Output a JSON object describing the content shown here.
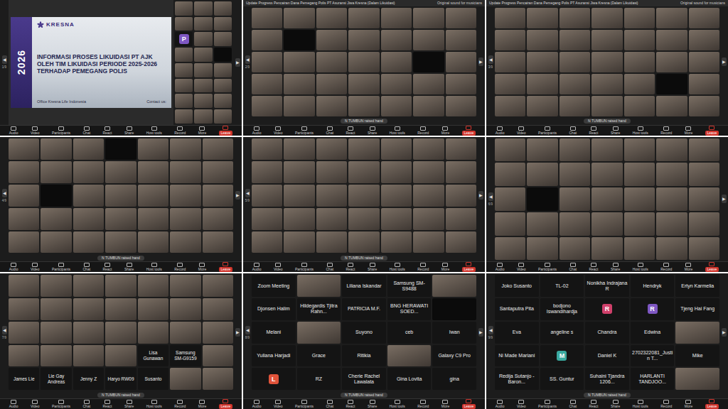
{
  "pager": {
    "prev": "◀",
    "next": "▶"
  },
  "toolbar": [
    {
      "label": "Audio",
      "kind": "button"
    },
    {
      "label": "Video",
      "kind": "button"
    },
    {
      "label": "Participants",
      "kind": "button"
    },
    {
      "label": "Chat",
      "kind": "button"
    },
    {
      "label": "React",
      "kind": "button"
    },
    {
      "label": "Share",
      "kind": "button"
    },
    {
      "label": "Host tools",
      "kind": "button"
    },
    {
      "label": "Record",
      "kind": "button"
    },
    {
      "label": "More",
      "kind": "button"
    },
    {
      "label": "Leave",
      "kind": "leave"
    }
  ],
  "panels": [
    {
      "kind": "slide",
      "header": null,
      "page": "1/9",
      "notice": null,
      "slide": {
        "year": "2026",
        "brand": "KRESNA",
        "title": "INFORMASI PROSES LIKUIDASI PT AJK OLEH TIM LIKUIDASI PERIODE 2025-2026 TERHADAP PEMEGANG POLIS",
        "office": "Office Kresna Life Indonesia",
        "contact": "Contact us:"
      },
      "tiles": [
        {
          "kind": "video"
        },
        {
          "kind": "video"
        },
        {
          "kind": "video"
        },
        {
          "kind": "video"
        },
        {
          "kind": "video"
        },
        {
          "kind": "video"
        },
        {
          "kind": "avatar",
          "letter": "P",
          "color": "#7e57c2"
        },
        {
          "kind": "video"
        },
        {
          "kind": "video"
        },
        {
          "kind": "video"
        },
        {
          "kind": "video"
        },
        {
          "kind": "blank"
        },
        {
          "kind": "video"
        },
        {
          "kind": "video"
        },
        {
          "kind": "video"
        },
        {
          "kind": "video"
        },
        {
          "kind": "video"
        },
        {
          "kind": "video"
        },
        {
          "kind": "video"
        },
        {
          "kind": "video"
        },
        {
          "kind": "video"
        },
        {
          "kind": "video"
        },
        {
          "kind": "video"
        },
        {
          "kind": "video"
        }
      ]
    },
    {
      "kind": "gallery",
      "header": {
        "title": "Update Progress Pencairan Dana Pemegang Polis PT Asuransi Jiwa Kresna (Dalam Likuidasi)",
        "status": "Original sound for musicians"
      },
      "page": "2/9",
      "notice": "N TUMBUN raised hand",
      "tiles": [
        {
          "kind": "video"
        },
        {
          "kind": "video"
        },
        {
          "kind": "video"
        },
        {
          "kind": "video"
        },
        {
          "kind": "video"
        },
        {
          "kind": "video"
        },
        {
          "kind": "video"
        },
        {
          "kind": "video"
        },
        {
          "kind": "blank"
        },
        {
          "kind": "video"
        },
        {
          "kind": "video"
        },
        {
          "kind": "video"
        },
        {
          "kind": "video"
        },
        {
          "kind": "video"
        },
        {
          "kind": "video"
        },
        {
          "kind": "video"
        },
        {
          "kind": "video"
        },
        {
          "kind": "video"
        },
        {
          "kind": "video"
        },
        {
          "kind": "blank"
        },
        {
          "kind": "video"
        },
        {
          "kind": "video"
        },
        {
          "kind": "video"
        },
        {
          "kind": "video"
        },
        {
          "kind": "video"
        },
        {
          "kind": "video"
        },
        {
          "kind": "video"
        },
        {
          "kind": "video"
        },
        {
          "kind": "video"
        },
        {
          "kind": "video"
        },
        {
          "kind": "video"
        },
        {
          "kind": "video"
        },
        {
          "kind": "video"
        },
        {
          "kind": "video"
        },
        {
          "kind": "video"
        }
      ]
    },
    {
      "kind": "gallery",
      "header": {
        "title": "Update Progress Pencairan Dana Pemegang Polis PT Asuransi Jiwa Kresna (Dalam Likuidasi)",
        "status": "Original sound for musicians"
      },
      "page": "3/9",
      "notice": "N TUMBUN raised hand",
      "tiles": [
        {
          "kind": "video"
        },
        {
          "kind": "video"
        },
        {
          "kind": "video"
        },
        {
          "kind": "video"
        },
        {
          "kind": "video"
        },
        {
          "kind": "video"
        },
        {
          "kind": "video"
        },
        {
          "kind": "video"
        },
        {
          "kind": "video"
        },
        {
          "kind": "video"
        },
        {
          "kind": "video"
        },
        {
          "kind": "video"
        },
        {
          "kind": "video"
        },
        {
          "kind": "video"
        },
        {
          "kind": "video"
        },
        {
          "kind": "video"
        },
        {
          "kind": "video"
        },
        {
          "kind": "video"
        },
        {
          "kind": "video"
        },
        {
          "kind": "video"
        },
        {
          "kind": "video"
        },
        {
          "kind": "video"
        },
        {
          "kind": "video"
        },
        {
          "kind": "video"
        },
        {
          "kind": "video"
        },
        {
          "kind": "video"
        },
        {
          "kind": "blank"
        },
        {
          "kind": "video"
        },
        {
          "kind": "video"
        },
        {
          "kind": "video"
        },
        {
          "kind": "video"
        },
        {
          "kind": "video"
        },
        {
          "kind": "video"
        },
        {
          "kind": "video"
        },
        {
          "kind": "video"
        }
      ]
    },
    {
      "kind": "gallery",
      "header": null,
      "page": "4/9",
      "notice": "N TUMBUN raised hand",
      "tiles": [
        {
          "kind": "video"
        },
        {
          "kind": "video"
        },
        {
          "kind": "video"
        },
        {
          "kind": "blank"
        },
        {
          "kind": "video"
        },
        {
          "kind": "video"
        },
        {
          "kind": "video"
        },
        {
          "kind": "video"
        },
        {
          "kind": "video"
        },
        {
          "kind": "video"
        },
        {
          "kind": "video"
        },
        {
          "kind": "video"
        },
        {
          "kind": "video"
        },
        {
          "kind": "video"
        },
        {
          "kind": "video"
        },
        {
          "kind": "blank"
        },
        {
          "kind": "video"
        },
        {
          "kind": "video"
        },
        {
          "kind": "video"
        },
        {
          "kind": "video"
        },
        {
          "kind": "video"
        },
        {
          "kind": "video"
        },
        {
          "kind": "video"
        },
        {
          "kind": "video"
        },
        {
          "kind": "video"
        },
        {
          "kind": "video"
        },
        {
          "kind": "video"
        },
        {
          "kind": "video"
        },
        {
          "kind": "video"
        },
        {
          "kind": "video"
        },
        {
          "kind": "video"
        },
        {
          "kind": "video"
        },
        {
          "kind": "video"
        },
        {
          "kind": "video"
        },
        {
          "kind": "video"
        }
      ]
    },
    {
      "kind": "gallery",
      "header": null,
      "page": "5/9",
      "notice": "N TUMBUN raised hand",
      "tiles": [
        {
          "kind": "video"
        },
        {
          "kind": "video"
        },
        {
          "kind": "video"
        },
        {
          "kind": "video"
        },
        {
          "kind": "video"
        },
        {
          "kind": "video"
        },
        {
          "kind": "video"
        },
        {
          "kind": "video"
        },
        {
          "kind": "video"
        },
        {
          "kind": "video"
        },
        {
          "kind": "video"
        },
        {
          "kind": "video"
        },
        {
          "kind": "video"
        },
        {
          "kind": "video"
        },
        {
          "kind": "video"
        },
        {
          "kind": "video"
        },
        {
          "kind": "video"
        },
        {
          "kind": "video"
        },
        {
          "kind": "video"
        },
        {
          "kind": "video"
        },
        {
          "kind": "video"
        },
        {
          "kind": "video"
        },
        {
          "kind": "video"
        },
        {
          "kind": "video"
        },
        {
          "kind": "video"
        },
        {
          "kind": "video"
        },
        {
          "kind": "video"
        },
        {
          "kind": "video"
        },
        {
          "kind": "video"
        },
        {
          "kind": "video"
        },
        {
          "kind": "video"
        },
        {
          "kind": "video"
        },
        {
          "kind": "video"
        },
        {
          "kind": "video"
        },
        {
          "kind": "video"
        }
      ]
    },
    {
      "kind": "gallery",
      "header": null,
      "page": "6/9",
      "notice": null,
      "tiles": [
        {
          "kind": "video"
        },
        {
          "kind": "video"
        },
        {
          "kind": "video"
        },
        {
          "kind": "video"
        },
        {
          "kind": "video"
        },
        {
          "kind": "video"
        },
        {
          "kind": "video"
        },
        {
          "kind": "video"
        },
        {
          "kind": "video"
        },
        {
          "kind": "video"
        },
        {
          "kind": "video"
        },
        {
          "kind": "video"
        },
        {
          "kind": "video"
        },
        {
          "kind": "video"
        },
        {
          "kind": "video"
        },
        {
          "kind": "blank"
        },
        {
          "kind": "video"
        },
        {
          "kind": "video"
        },
        {
          "kind": "video"
        },
        {
          "kind": "video"
        },
        {
          "kind": "video"
        },
        {
          "kind": "video"
        },
        {
          "kind": "video"
        },
        {
          "kind": "video"
        },
        {
          "kind": "video"
        },
        {
          "kind": "video"
        },
        {
          "kind": "video"
        },
        {
          "kind": "video"
        },
        {
          "kind": "video"
        },
        {
          "kind": "video"
        },
        {
          "kind": "video"
        },
        {
          "kind": "video"
        },
        {
          "kind": "video"
        },
        {
          "kind": "video"
        },
        {
          "kind": "video"
        }
      ]
    },
    {
      "kind": "gallery",
      "header": null,
      "page": "7/9",
      "notice": "N TUMBUN raised hand",
      "tiles": [
        {
          "kind": "video"
        },
        {
          "kind": "video"
        },
        {
          "kind": "video"
        },
        {
          "kind": "video"
        },
        {
          "kind": "video"
        },
        {
          "kind": "video"
        },
        {
          "kind": "video"
        },
        {
          "kind": "video"
        },
        {
          "kind": "video"
        },
        {
          "kind": "video"
        },
        {
          "kind": "video"
        },
        {
          "kind": "video"
        },
        {
          "kind": "video"
        },
        {
          "kind": "video"
        },
        {
          "kind": "video"
        },
        {
          "kind": "video"
        },
        {
          "kind": "video"
        },
        {
          "kind": "video"
        },
        {
          "kind": "video"
        },
        {
          "kind": "video"
        },
        {
          "kind": "video"
        },
        {
          "kind": "video"
        },
        {
          "kind": "video"
        },
        {
          "kind": "video"
        },
        {
          "kind": "video"
        },
        {
          "kind": "off",
          "name": "Lisa Gunawan"
        },
        {
          "kind": "off",
          "name": "Samsung SM-G9159"
        },
        {
          "kind": "video"
        },
        {
          "kind": "off",
          "name": "James Lie"
        },
        {
          "kind": "off",
          "name": "Lie Gay Andreas"
        },
        {
          "kind": "off",
          "name": "Jenny Z"
        },
        {
          "kind": "off",
          "name": "Haryo RW09"
        },
        {
          "kind": "off",
          "name": "Susanto"
        },
        {
          "kind": "video"
        },
        {
          "kind": "video"
        }
      ]
    },
    {
      "kind": "names",
      "header": null,
      "page": "8/9",
      "notice": "N TUMBUN raised hand",
      "tiles": [
        {
          "kind": "off",
          "name": "Zoom Meeting"
        },
        {
          "kind": "video"
        },
        {
          "kind": "off",
          "name": "Liliana Iskandar"
        },
        {
          "kind": "off",
          "name": "Samsung SM-S9488"
        },
        {
          "kind": "video"
        },
        {
          "kind": "off",
          "name": "Djonsen Halim"
        },
        {
          "kind": "off",
          "name": "Hildegardis Tjitra Rahn..."
        },
        {
          "kind": "off",
          "name": "PATRICIA M.F."
        },
        {
          "kind": "off",
          "name": "BNG HERAWATI SOED..."
        },
        {
          "kind": "blank"
        },
        {
          "kind": "off",
          "name": "Melani"
        },
        {
          "kind": "video"
        },
        {
          "kind": "off",
          "name": "Suyono"
        },
        {
          "kind": "off",
          "name": "ceb"
        },
        {
          "kind": "off",
          "name": "Iwan"
        },
        {
          "kind": "off",
          "name": "Yuliana Harjadi"
        },
        {
          "kind": "off",
          "name": "Grace"
        },
        {
          "kind": "off",
          "name": "Ritikia"
        },
        {
          "kind": "video"
        },
        {
          "kind": "off",
          "name": "Galaxy C9 Pro"
        },
        {
          "kind": "avatar",
          "letter": "L",
          "color": "#e0533a"
        },
        {
          "kind": "off",
          "name": "RZ"
        },
        {
          "kind": "off",
          "name": "Cherie Rachel Lawalata"
        },
        {
          "kind": "off",
          "name": "Gina Lovita"
        },
        {
          "kind": "off",
          "name": "gina"
        }
      ]
    },
    {
      "kind": "names",
      "header": null,
      "page": "9/9",
      "notice": "N TUMBUN raised hand",
      "tiles": [
        {
          "kind": "off",
          "name": "Joko Susanto"
        },
        {
          "kind": "off",
          "name": "TL-02"
        },
        {
          "kind": "off",
          "name": "Nonikha Indrajana R"
        },
        {
          "kind": "off",
          "name": "Hendryk"
        },
        {
          "kind": "off",
          "name": "Ertyn Karmelia"
        },
        {
          "kind": "off",
          "name": "Santaputra Pita"
        },
        {
          "kind": "off",
          "name": "bodjono Iswandihardja"
        },
        {
          "kind": "avatar",
          "letter": "R",
          "color": "#d0406a"
        },
        {
          "kind": "avatar",
          "letter": "R",
          "color": "#7e57c2"
        },
        {
          "kind": "off",
          "name": "Tjeng Hai Fang"
        },
        {
          "kind": "off",
          "name": "Eva"
        },
        {
          "kind": "off",
          "name": "angeline s"
        },
        {
          "kind": "off",
          "name": "Chandra"
        },
        {
          "kind": "off",
          "name": "Edwina"
        },
        {
          "kind": "video"
        },
        {
          "kind": "off",
          "name": "Ni Made Mariani"
        },
        {
          "kind": "avatar",
          "letter": "M",
          "color": "#3aa99f"
        },
        {
          "kind": "off",
          "name": "Daniel K"
        },
        {
          "kind": "off",
          "name": "2702322081_Justin T..."
        },
        {
          "kind": "off",
          "name": "Mike"
        },
        {
          "kind": "off",
          "name": "Redija Sutanjo - Baron..."
        },
        {
          "kind": "off",
          "name": "SS. Guntur"
        },
        {
          "kind": "off",
          "name": "Suhaini Tjandra 1206..."
        },
        {
          "kind": "off",
          "name": "HARLANTI TANDJOO..."
        },
        {
          "kind": "video"
        }
      ]
    }
  ]
}
